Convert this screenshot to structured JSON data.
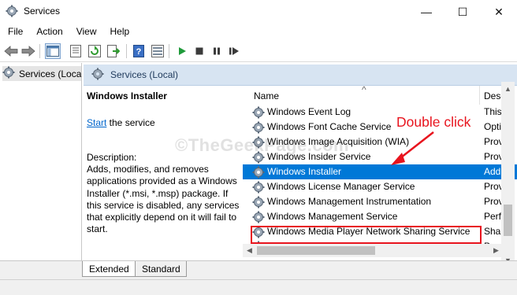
{
  "window": {
    "title": "Services",
    "minimize_glyph": "—",
    "maximize_glyph": "☐",
    "close_glyph": "✕"
  },
  "menu": [
    "File",
    "Action",
    "View",
    "Help"
  ],
  "toolbar_icons": [
    "back-arrow-icon",
    "forward-arrow-icon",
    "show-console-tree-icon",
    "properties-icon",
    "refresh-icon",
    "export-list-icon",
    "help-icon",
    "details-view-icon",
    "start-service-icon",
    "stop-service-icon",
    "pause-service-icon",
    "restart-service-icon"
  ],
  "tree": {
    "item_label": "Services (Loca"
  },
  "right_header": {
    "title": "Services (Local)"
  },
  "description_panel": {
    "service_name": "Windows Installer",
    "start_link": "Start",
    "start_suffix": " the service",
    "description_label": "Description:",
    "description_text": "Adds, modifies, and removes applications provided as a Windows Installer (*.msi, *.msp) package. If this service is disabled, any services that explicitly depend on it will fail to start."
  },
  "list": {
    "column_name": "Name",
    "column_desc": "Desc",
    "sort_indicator": "^",
    "rows": [
      {
        "name": "Windows Event Log",
        "desc": "This"
      },
      {
        "name": "Windows Font Cache Service",
        "desc": "Opti"
      },
      {
        "name": "Windows Image Acquisition (WIA)",
        "desc": "Prov"
      },
      {
        "name": "Windows Insider Service",
        "desc": "Prov"
      },
      {
        "name": "Windows Installer",
        "desc": "Add",
        "selected": true
      },
      {
        "name": "Windows License Manager Service",
        "desc": "Prov"
      },
      {
        "name": "Windows Management Instrumentation",
        "desc": "Prov"
      },
      {
        "name": "Windows Management Service",
        "desc": "Perf"
      },
      {
        "name": "Windows Media Player Network Sharing Service",
        "desc": "Shar"
      },
      {
        "name": "Windows Mobile Hotspot Service",
        "desc": "Prov"
      }
    ]
  },
  "tabs": {
    "extended": "Extended",
    "standard": "Standard"
  },
  "annotation": {
    "text": "Double click",
    "color": "#e8141e"
  },
  "watermark": "©TheGeekPage.com",
  "colors": {
    "selection": "#0078d7",
    "header_bg": "#d7e4f2",
    "link": "#0066cc"
  }
}
